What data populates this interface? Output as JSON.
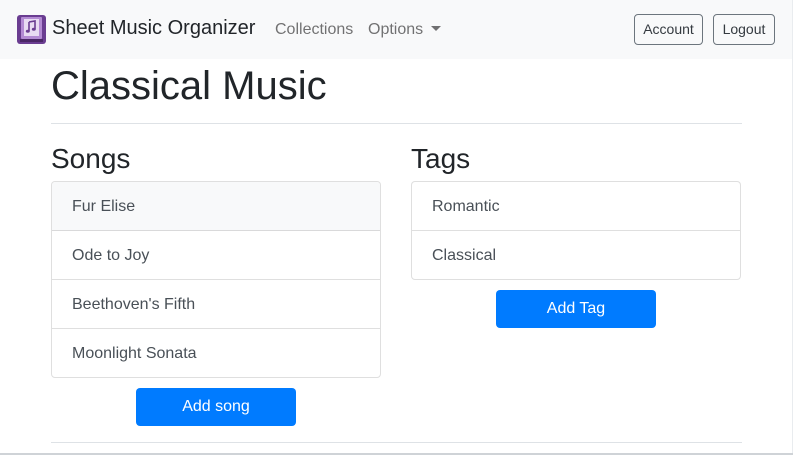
{
  "navbar": {
    "brand": "Sheet Music Organizer",
    "logo_icon": "sheet-music-book-icon",
    "links": [
      "Collections",
      "Options"
    ],
    "account_label": "Account",
    "logout_label": "Logout"
  },
  "page": {
    "title": "Classical Music"
  },
  "songs": {
    "heading": "Songs",
    "items": [
      "Fur Elise",
      "Ode to Joy",
      "Beethoven's Fifth",
      "Moonlight Sonata"
    ],
    "add_label": "Add song"
  },
  "tags": {
    "heading": "Tags",
    "items": [
      "Romantic",
      "Classical"
    ],
    "add_label": "Add Tag"
  },
  "colors": {
    "primary": "#007bff",
    "navbar_bg": "#f8f9fa",
    "logo_purple": "#7b4ba0"
  }
}
